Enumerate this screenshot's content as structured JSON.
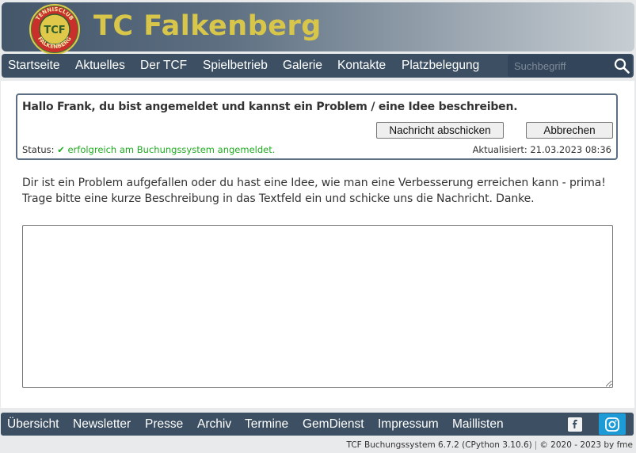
{
  "header": {
    "title": "TC Falkenberg",
    "logo_text_top": "TENNISCLUB",
    "logo_text_center": "TCF",
    "logo_text_bottom": "FALKENBERG"
  },
  "nav": {
    "items": [
      "Startseite",
      "Aktuelles",
      "Der TCF",
      "Spielbetrieb",
      "Galerie",
      "Kontakte",
      "Platzbelegung"
    ],
    "search_placeholder": "Suchbegriff"
  },
  "panel": {
    "heading": "Hallo Frank, du bist angemeldet und kannst ein Problem / eine Idee beschreiben.",
    "send_label": "Nachricht abschicken",
    "cancel_label": "Abbrechen",
    "status_label": "Status:",
    "status_value": "✔ erfolgreich am Buchungssystem angemeldet.",
    "updated": "Aktualisiert: 21.03.2023 08:36"
  },
  "intro": {
    "line1": "Dir ist ein Problem aufgefallen oder du hast eine Idee, wie man eine Verbesserung erreichen kann - prima!",
    "line2": "Trage bitte eine kurze Beschreibung in das Textfeld ein und schicke uns die Nachricht. Danke."
  },
  "message": {
    "value": ""
  },
  "footer_nav": {
    "items": [
      "Übersicht",
      "Newsletter",
      "Presse",
      "Archiv",
      "Termine",
      "GemDienst",
      "Impressum",
      "Maillisten"
    ],
    "facebook_icon": "facebook-icon",
    "instagram_icon": "instagram-icon"
  },
  "footer": {
    "version": "TCF Buchungssystem 6.7.2 (CPython 3.10.6)",
    "copyright": "© 2020 - 2023 by fme"
  },
  "colors": {
    "nav_bg": "#3d5063",
    "title": "#d8c64b",
    "status_ok": "#22aa22",
    "instagram_bg": "#1d9bd6"
  }
}
